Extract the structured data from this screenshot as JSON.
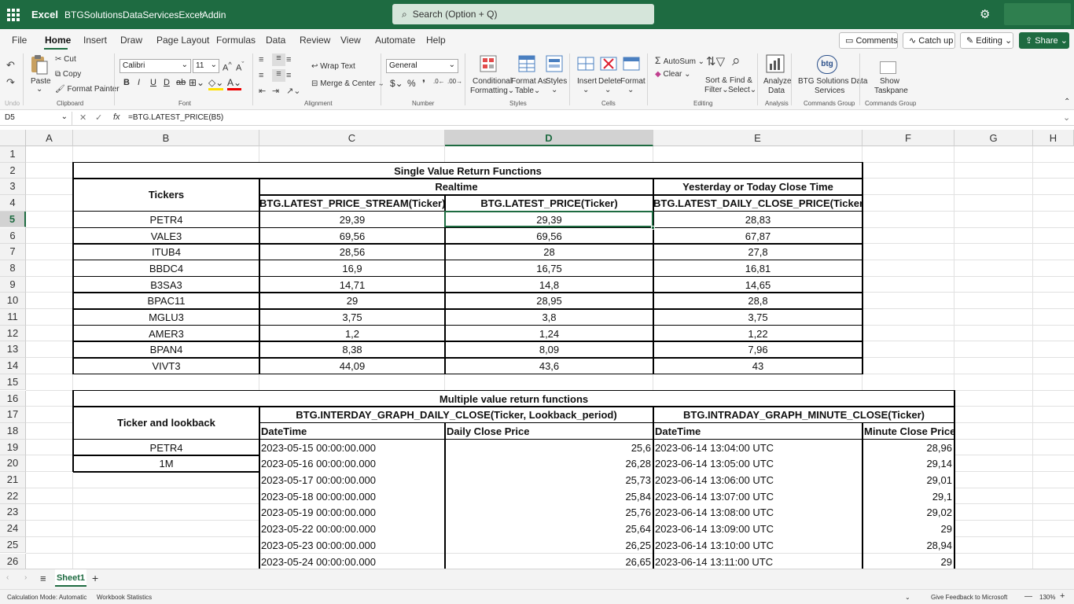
{
  "titlebar": {
    "app_name": "Excel",
    "doc_name": "BTGSolutionsDataServicesExcelAddin",
    "search_placeholder": "Search (Option + Q)"
  },
  "menu": {
    "tabs": [
      "File",
      "Home",
      "Insert",
      "Draw",
      "Page Layout",
      "Formulas",
      "Data",
      "Review",
      "View",
      "Automate",
      "Help"
    ],
    "active_tab": "Home",
    "comments": "Comments",
    "catchup": "Catch up",
    "editing": "Editing",
    "share": "Share"
  },
  "ribbon": {
    "undo_group": "Undo",
    "paste": "Paste",
    "cut": "Cut",
    "copy": "Copy",
    "format_painter": "Format Painter",
    "clipboard_group": "Clipboard",
    "font_name": "Calibri",
    "font_size": "11",
    "font_group": "Font",
    "wrap_text": "Wrap Text",
    "merge_center": "Merge & Center",
    "alignment_group": "Alignment",
    "number_format": "General",
    "number_group": "Number",
    "conditional_formatting_1": "Conditional",
    "conditional_formatting_2": "Formatting",
    "format_as_table_1": "Format As",
    "format_as_table_2": "Table",
    "styles": "Styles",
    "styles_group": "Styles",
    "insert": "Insert",
    "delete": "Delete",
    "format": "Format",
    "cells_group": "Cells",
    "autosum": "AutoSum",
    "clear": "Clear",
    "sort_filter_1": "Sort &",
    "sort_filter_2": "Filter",
    "find_select_1": "Find &",
    "find_select_2": "Select",
    "editing_group": "Editing",
    "analyze_data_1": "Analyze",
    "analyze_data_2": "Data",
    "analysis_group": "Analysis",
    "btg_services_1": "BTG Solutions Data",
    "btg_services_2": "Services",
    "btg_logo": "btg",
    "commands_group_1": "Commands Group",
    "show_taskpane_1": "Show",
    "show_taskpane_2": "Taskpane",
    "commands_group_2": "Commands Group"
  },
  "formula_bar": {
    "name_box": "D5",
    "formula": "=BTG.LATEST_PRICE(B5)"
  },
  "columns": [
    "A",
    "B",
    "C",
    "D",
    "E",
    "F",
    "G",
    "H"
  ],
  "rows": [
    "1",
    "2",
    "3",
    "4",
    "5",
    "6",
    "7",
    "8",
    "9",
    "10",
    "11",
    "12",
    "13",
    "14",
    "15",
    "16",
    "17",
    "18",
    "19",
    "20",
    "21",
    "22",
    "23",
    "24",
    "25",
    "26"
  ],
  "single": {
    "title": "Single Value Return Functions",
    "tickers_header": "Tickers",
    "realtime": "Realtime",
    "close_time": "Yesterday or Today Close Time",
    "stream_header": "BTG.LATEST_PRICE_STREAM(Ticker)",
    "latest_header": "BTG.LATEST_PRICE(Ticker)",
    "daily_close_header": "BTG.LATEST_DAILY_CLOSE_PRICE(Ticker)",
    "rows": [
      {
        "ticker": "PETR4",
        "stream": "29,39",
        "latest": "29,39",
        "close": "28,83"
      },
      {
        "ticker": "VALE3",
        "stream": "69,56",
        "latest": "69,56",
        "close": "67,87"
      },
      {
        "ticker": "ITUB4",
        "stream": "28,56",
        "latest": "28",
        "close": "27,8"
      },
      {
        "ticker": "BBDC4",
        "stream": "16,9",
        "latest": "16,75",
        "close": "16,81"
      },
      {
        "ticker": "B3SA3",
        "stream": "14,71",
        "latest": "14,8",
        "close": "14,65"
      },
      {
        "ticker": "BPAC11",
        "stream": "29",
        "latest": "28,95",
        "close": "28,8"
      },
      {
        "ticker": "MGLU3",
        "stream": "3,75",
        "latest": "3,8",
        "close": "3,75"
      },
      {
        "ticker": "AMER3",
        "stream": "1,2",
        "latest": "1,24",
        "close": "1,22"
      },
      {
        "ticker": "BPAN4",
        "stream": "8,38",
        "latest": "8,09",
        "close": "7,96"
      },
      {
        "ticker": "VIVT3",
        "stream": "44,09",
        "latest": "43,6",
        "close": "43"
      }
    ]
  },
  "multiple": {
    "title": "Multiple value return functions",
    "ticker_lookback": "Ticker and lookback",
    "interday_header": "BTG.INTERDAY_GRAPH_DAILY_CLOSE(Ticker, Lookback_period)",
    "intraday_header": "BTG.INTRADAY_GRAPH_MINUTE_CLOSE(Ticker)",
    "datetime_1": "DateTime",
    "daily_close_price": "Daily Close Price",
    "datetime_2": "DateTime",
    "minute_close_price": "Minute Close Price",
    "ticker_value": "PETR4",
    "lookback_value": "1M",
    "rows": [
      {
        "d1": "2023-05-15 00:00:00.000",
        "p1": "25,6",
        "d2": "2023-06-14 13:04:00 UTC",
        "p2": "28,96"
      },
      {
        "d1": "2023-05-16 00:00:00.000",
        "p1": "26,28",
        "d2": "2023-06-14 13:05:00 UTC",
        "p2": "29,14"
      },
      {
        "d1": "2023-05-17 00:00:00.000",
        "p1": "25,73",
        "d2": "2023-06-14 13:06:00 UTC",
        "p2": "29,01"
      },
      {
        "d1": "2023-05-18 00:00:00.000",
        "p1": "25,84",
        "d2": "2023-06-14 13:07:00 UTC",
        "p2": "29,1"
      },
      {
        "d1": "2023-05-19 00:00:00.000",
        "p1": "25,76",
        "d2": "2023-06-14 13:08:00 UTC",
        "p2": "29,02"
      },
      {
        "d1": "2023-05-22 00:00:00.000",
        "p1": "25,64",
        "d2": "2023-06-14 13:09:00 UTC",
        "p2": "29"
      },
      {
        "d1": "2023-05-23 00:00:00.000",
        "p1": "26,25",
        "d2": "2023-06-14 13:10:00 UTC",
        "p2": "28,94"
      },
      {
        "d1": "2023-05-24 00:00:00.000",
        "p1": "26,65",
        "d2": "2023-06-14 13:11:00 UTC",
        "p2": "29"
      }
    ]
  },
  "sheets": {
    "active": "Sheet1"
  },
  "status": {
    "calc_mode": "Calculation Mode: Automatic",
    "workbook_stats": "Workbook Statistics",
    "feedback": "Give Feedback to Microsoft",
    "zoom": "130%"
  },
  "colors": {
    "brand": "#1e6b41"
  }
}
